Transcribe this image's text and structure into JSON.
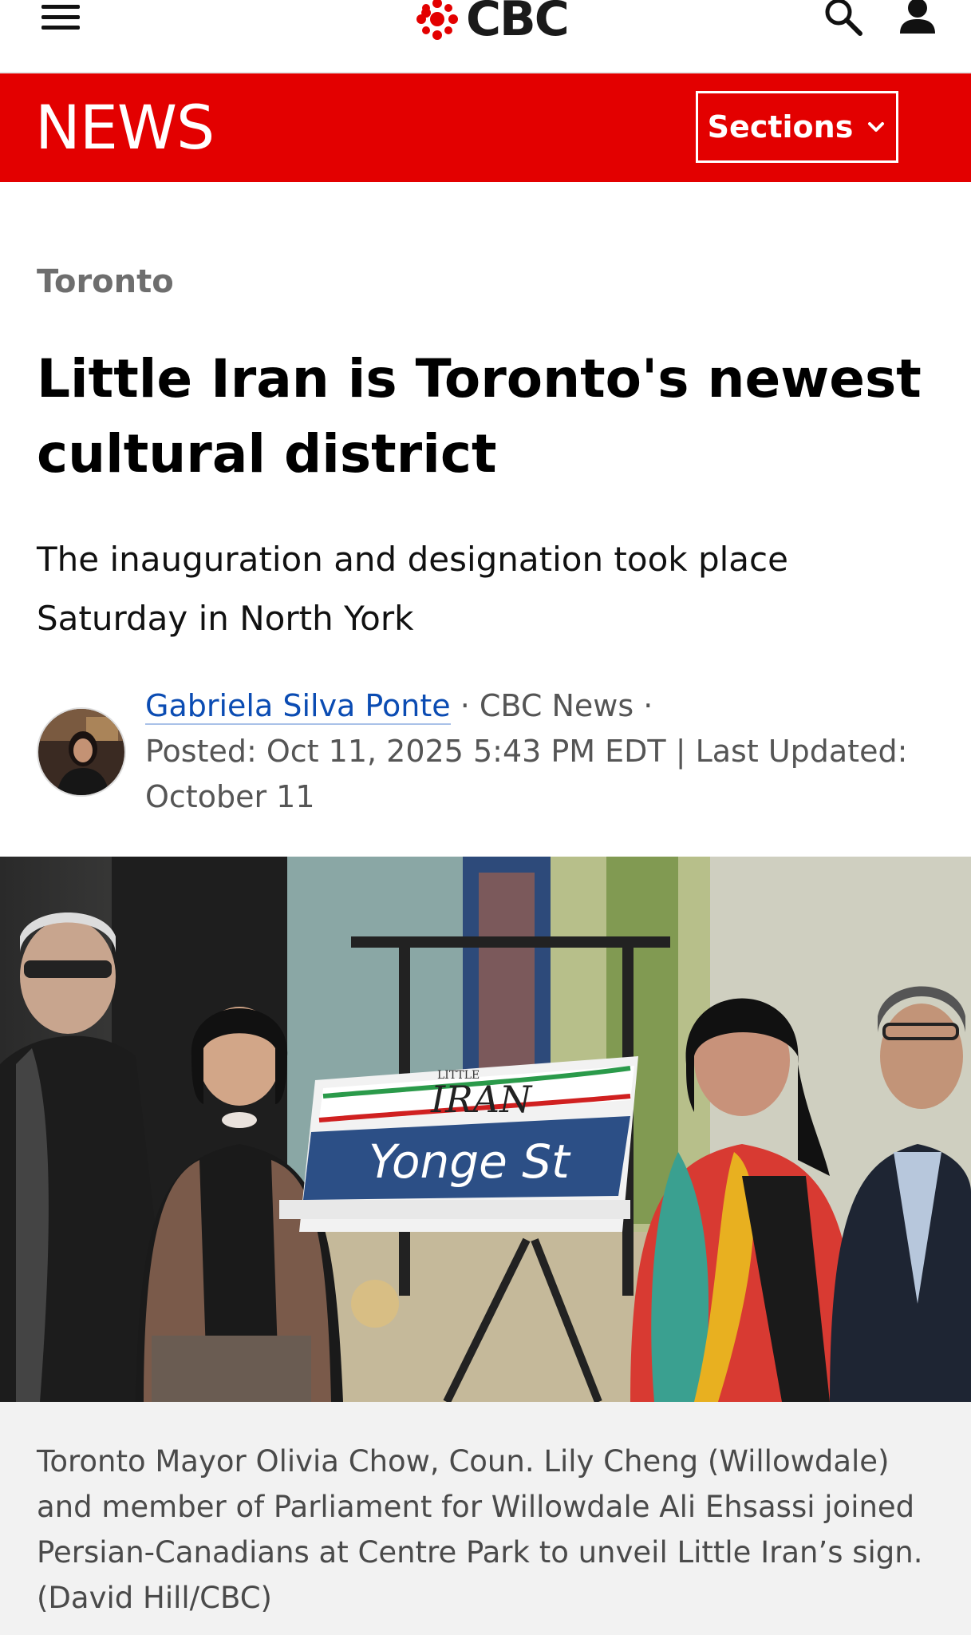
{
  "header": {
    "logo_text": "CBC",
    "logo_icon": "cbc-gem-logo",
    "menu_icon": "hamburger-menu-icon",
    "search_icon": "search-icon",
    "user_icon": "user-icon"
  },
  "newsbar": {
    "label": "NEWS",
    "sections_label": "Sections",
    "sections_icon": "chevron-down-icon",
    "color": "#e30000"
  },
  "article": {
    "category": "Toronto",
    "headline": "Little Iran is Toronto's newest cultural district",
    "dek": "The inauguration and designation took place Saturday in North York",
    "byline": {
      "author": "Gabriela Silva Ponte",
      "outlet": "CBC News",
      "separator": "·",
      "posted": "Posted: Oct 11, 2025 5:43 PM EDT | Last Updated: October 11"
    },
    "photo": {
      "sign_top": "LITTLE",
      "sign_name": "IRAN",
      "sign_street": "Yonge St"
    },
    "caption": "Toronto Mayor Olivia Chow, Coun. Lily Cheng (Willowdale) and member of Parliament for Willowdale Ali Ehsassi joined Persian-Canadians at Centre Park to unveil Little Iran’s sign. (David Hill/CBC)"
  }
}
